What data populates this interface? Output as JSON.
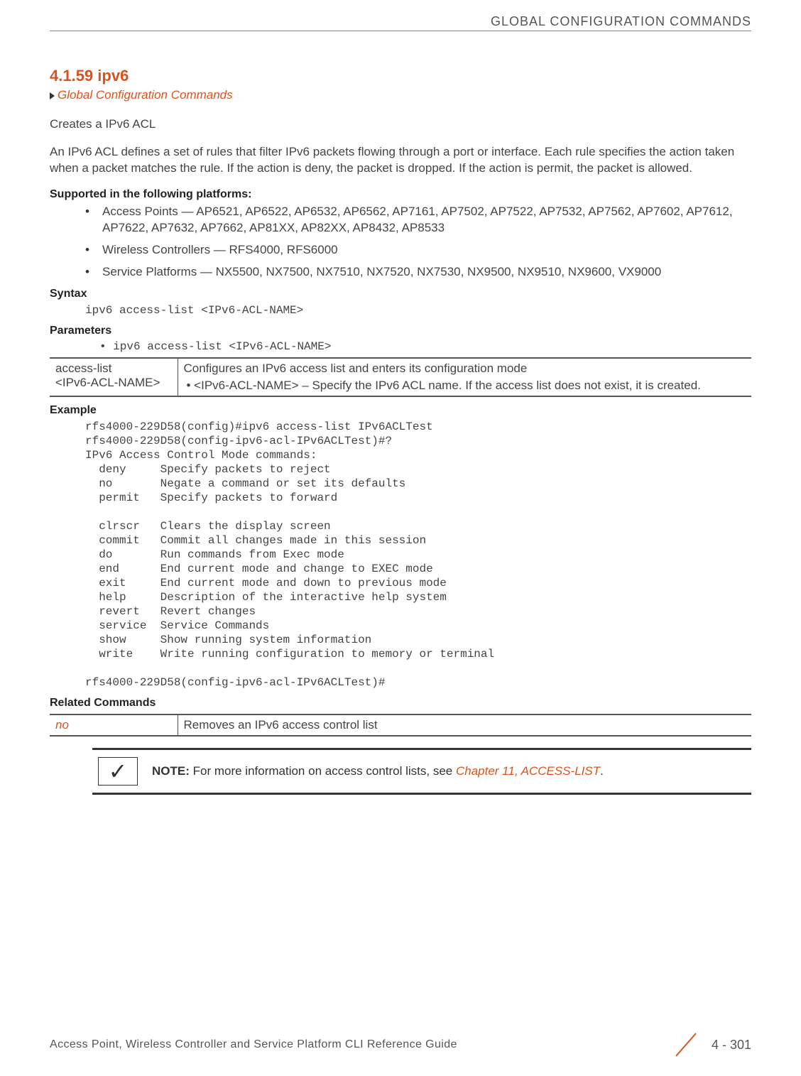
{
  "header": {
    "chapter_title": "GLOBAL CONFIGURATION COMMANDS"
  },
  "section": {
    "number": "4.1.59 ipv6",
    "breadcrumb": "Global Configuration Commands",
    "intro_short": "Creates a IPv6 ACL",
    "intro_long": "An IPv6 ACL defines a set of rules that filter IPv6 packets flowing through a port or interface. Each rule specifies the action taken when a packet matches the rule. If the action is deny, the packet is dropped. If the action is permit, the packet is allowed."
  },
  "platforms": {
    "heading": "Supported in the following platforms:",
    "items": [
      "Access Points — AP6521, AP6522, AP6532, AP6562, AP7161, AP7502, AP7522, AP7532, AP7562, AP7602, AP7612, AP7622, AP7632, AP7662, AP81XX, AP82XX, AP8432, AP8533",
      "Wireless Controllers — RFS4000, RFS6000",
      "Service Platforms — NX5500, NX7500, NX7510, NX7520, NX7530, NX9500, NX9510, NX9600, VX9000"
    ]
  },
  "syntax": {
    "heading": "Syntax",
    "code": "ipv6 access-list <IPv6-ACL-NAME>"
  },
  "parameters": {
    "heading": "Parameters",
    "bullet": "• ipv6 access-list <IPv6-ACL-NAME>",
    "table": {
      "col1": "access-list\n<IPv6-ACL-NAME>",
      "col2_main": "Configures an IPv6 access list and enters its configuration mode",
      "col2_sub": "• <IPv6-ACL-NAME> – Specify the IPv6 ACL name. If the access list does not exist, it is created."
    }
  },
  "example": {
    "heading": "Example",
    "code": "rfs4000-229D58(config)#ipv6 access-list IPv6ACLTest\nrfs4000-229D58(config-ipv6-acl-IPv6ACLTest)#?\nIPv6 Access Control Mode commands:\n  deny     Specify packets to reject\n  no       Negate a command or set its defaults\n  permit   Specify packets to forward\n\n  clrscr   Clears the display screen\n  commit   Commit all changes made in this session\n  do       Run commands from Exec mode\n  end      End current mode and change to EXEC mode\n  exit     End current mode and down to previous mode\n  help     Description of the interactive help system\n  revert   Revert changes\n  service  Service Commands\n  show     Show running system information\n  write    Write running configuration to memory or terminal\n\nrfs4000-229D58(config-ipv6-acl-IPv6ACLTest)#"
  },
  "related": {
    "heading": "Related Commands",
    "cmd": "no",
    "desc": "Removes an IPv6 access control list"
  },
  "note": {
    "label": "NOTE:",
    "text": " For more information on access control lists, see ",
    "link": "Chapter 11, ACCESS-LIST",
    "tail": "."
  },
  "footer": {
    "title": "Access Point, Wireless Controller and Service Platform CLI Reference Guide",
    "page": "4 - 301"
  }
}
